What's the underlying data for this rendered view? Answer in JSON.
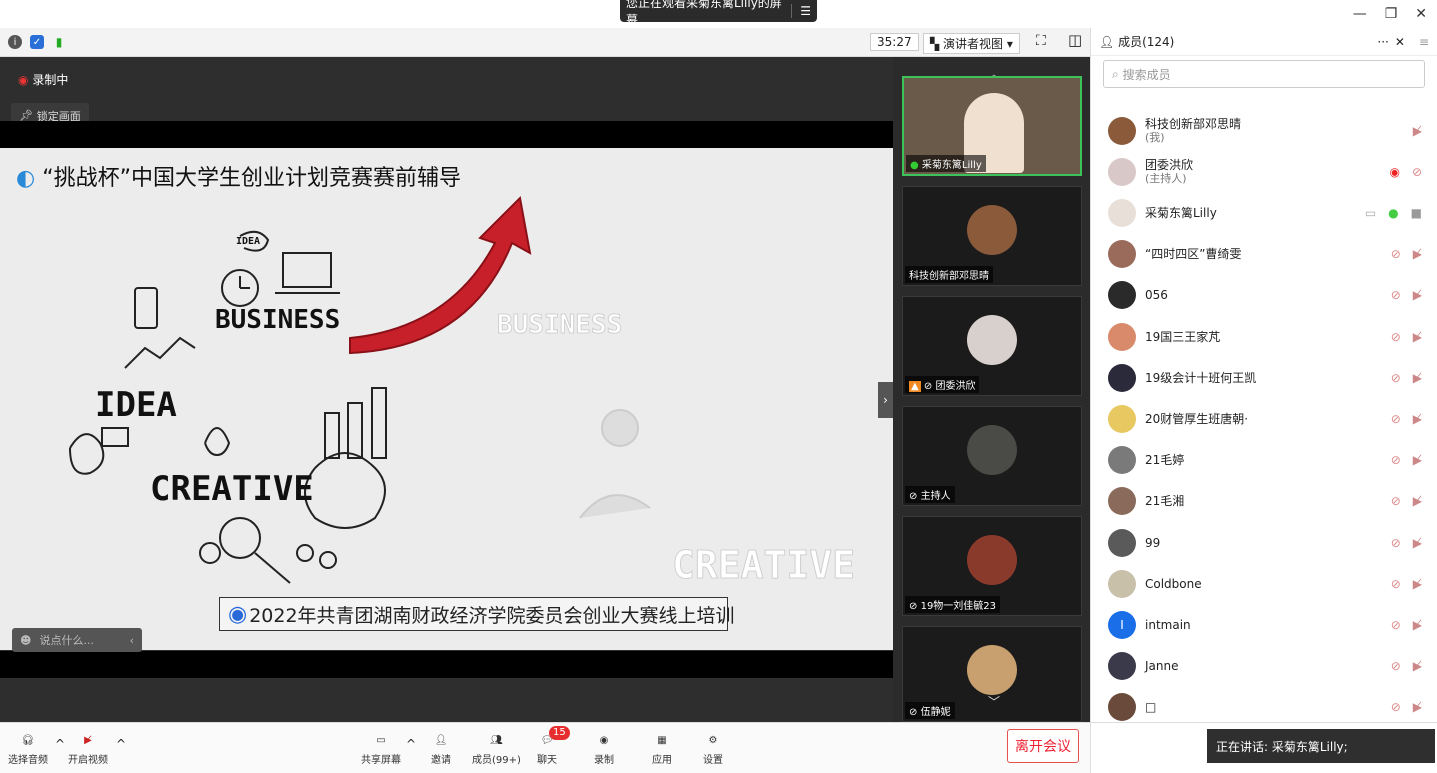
{
  "share_banner": {
    "text": "您正在观看采菊东篱Lilly的屏幕",
    "menu_icon": "menu-icon"
  },
  "top_bar": {
    "timer": "35:27",
    "view_label": "演讲者视图"
  },
  "stage": {
    "recording_label": "录制中",
    "lock_label": "锁定画面",
    "slide_title": "“挑战杯”中国大学生创业计划竞赛赛前辅导",
    "slide_footer": "2022年共青团湖南财政经济学院委员会创业大赛线上培训",
    "chat_placeholder": "说点什么...",
    "doodle_words": {
      "business": "BUSINESS",
      "idea": "IDEA",
      "creative": "CREATIVE",
      "small_idea": "IDEA",
      "ghost_business": "BUSINESS",
      "ghost_creative": "CREATIVE"
    }
  },
  "video_tiles": [
    {
      "name": "采菊东篱Lilly",
      "mic": "on",
      "avatar_color": "#7a6a5a"
    },
    {
      "name": "科技创新部邓思晴",
      "mic": "none",
      "avatar_color": "#8a5a3a"
    },
    {
      "name": "团委洪欣",
      "mic": "off",
      "avatar_color": "#d8d0cc"
    },
    {
      "name": "主持人",
      "mic": "off",
      "avatar_color": "#4a4a46"
    },
    {
      "name": "19物一刘佳毓23",
      "mic": "off",
      "avatar_color": "#8a3a2a"
    },
    {
      "name": "伍静妮",
      "mic": "off",
      "avatar_color": "#c8a070"
    }
  ],
  "panel": {
    "title": "成员(124)",
    "search_placeholder": "搜索成员",
    "members": [
      {
        "name": "科技创新部邓思晴",
        "sub": "(我)",
        "color": "#8a5a3a"
      },
      {
        "name": "团委洪欣",
        "sub": "(主持人)",
        "color": "#d8c8c8",
        "recording": true
      },
      {
        "name": "采菊东篱Lilly",
        "sub": "",
        "color": "#e8e0d8",
        "mic_on": true
      },
      {
        "name": "“四时四区”曹绮雯",
        "sub": "",
        "color": "#9a6a5a"
      },
      {
        "name": "056",
        "sub": "",
        "color": "#2a2a2a"
      },
      {
        "name": "19国三王家芃",
        "sub": "",
        "color": "#d88a6a"
      },
      {
        "name": "19级会计十班何王凯",
        "sub": "",
        "color": "#2a2a3a"
      },
      {
        "name": "20财管厚生班唐朝·",
        "sub": "",
        "color": "#e8c860"
      },
      {
        "name": "21毛婷",
        "sub": "",
        "color": "#7a7a7a"
      },
      {
        "name": "21毛湘",
        "sub": "",
        "color": "#8a6a5a"
      },
      {
        "name": "99",
        "sub": "",
        "color": "#5a5a5a"
      },
      {
        "name": "Coldbone",
        "sub": "",
        "color": "#c8c0a8"
      },
      {
        "name": "intmain",
        "sub": "",
        "color": "#1a6ee8",
        "letter": "I"
      },
      {
        "name": "Janne",
        "sub": "",
        "color": "#3a3a4a"
      },
      {
        "name": "□",
        "sub": "",
        "color": "#6a4a3a"
      }
    ]
  },
  "toolbar": {
    "audio": "选择音频",
    "video": "开启视频",
    "share": "共享屏幕",
    "invite": "邀请",
    "members": "成员(99+)",
    "chat": "聊天",
    "chat_badge": "15",
    "record": "录制",
    "apps": "应用",
    "settings": "设置",
    "leave": "离开会议"
  },
  "speaking_now": "正在讲话: 采菊东篱Lilly;"
}
